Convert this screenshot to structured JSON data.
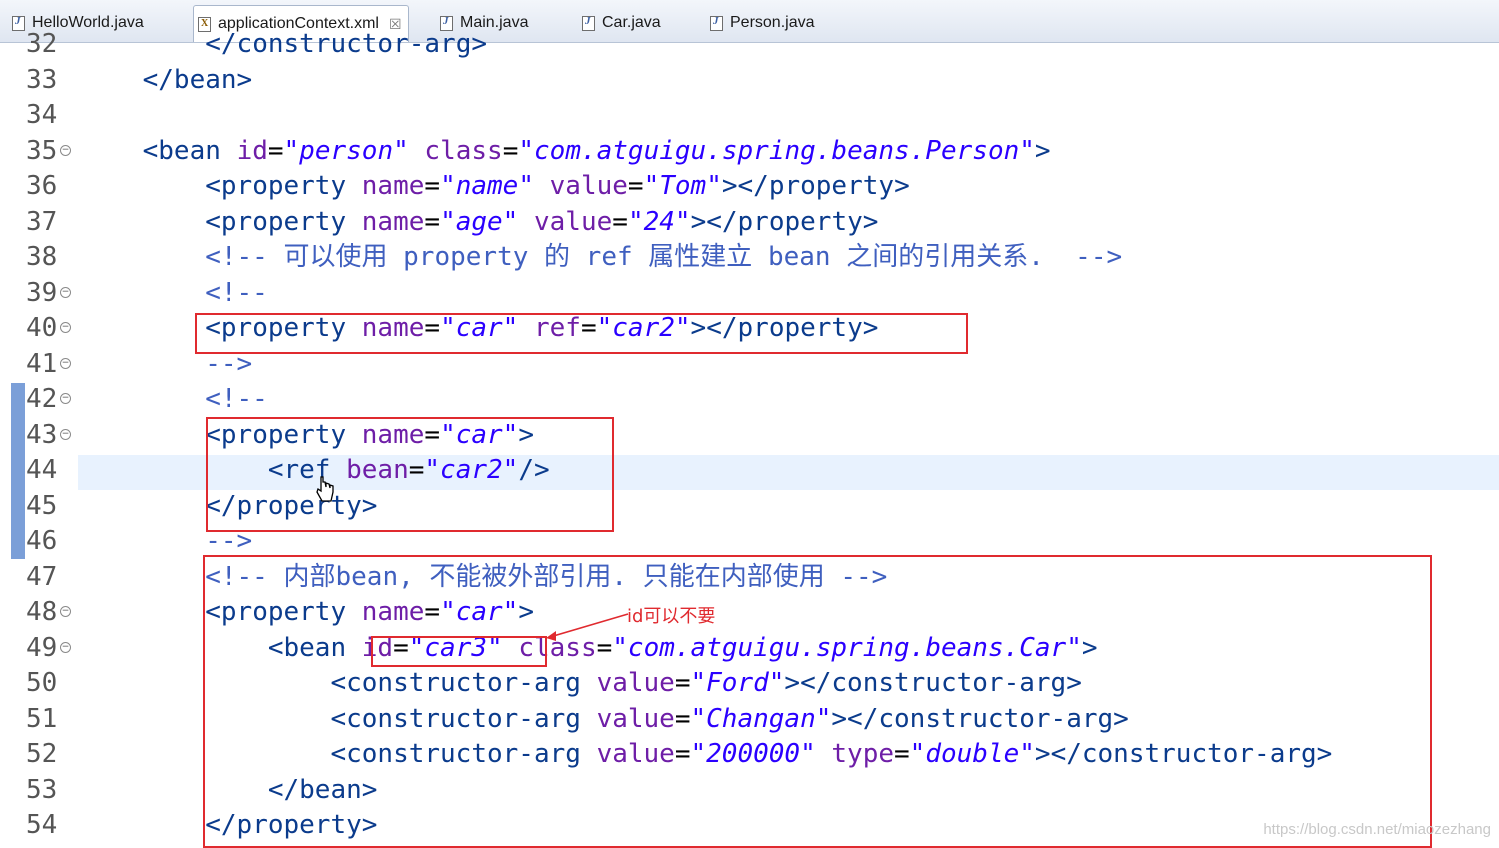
{
  "tabs": [
    {
      "label": "HelloWorld.java",
      "icon": "java-file-icon"
    },
    {
      "label": "applicationContext.xml",
      "icon": "xml-file-icon",
      "active": true,
      "close": "☒"
    },
    {
      "label": "Main.java",
      "icon": "java-file-icon"
    },
    {
      "label": "Car.java",
      "icon": "java-file-icon"
    },
    {
      "label": "Person.java",
      "icon": "java-file-icon"
    }
  ],
  "lines": [
    {
      "n": "32",
      "code": "        </constructor-arg>"
    },
    {
      "n": "33",
      "code": "    </bean>"
    },
    {
      "n": "34",
      "code": ""
    },
    {
      "n": "35",
      "code": "    <bean id=\"person\" class=\"com.atguigu.spring.beans.Person\">",
      "fold": true
    },
    {
      "n": "36",
      "code": "        <property name=\"name\" value=\"Tom\"></property>"
    },
    {
      "n": "37",
      "code": "        <property name=\"age\" value=\"24\"></property>"
    },
    {
      "n": "38",
      "code": "        <!-- 可以使用 property 的 ref 属性建立 bean 之间的引用关系.  -->"
    },
    {
      "n": "39",
      "code": "        <!--",
      "fold": true
    },
    {
      "n": "40",
      "code": "        <property name=\"car\" ref=\"car2\"></property>",
      "fold": true
    },
    {
      "n": "41",
      "code": "        -->",
      "fold": true
    },
    {
      "n": "42",
      "code": "        <!--",
      "fold": true
    },
    {
      "n": "43",
      "code": "        <property name=\"car\">",
      "fold": true
    },
    {
      "n": "44",
      "code": "            <ref bean=\"car2\"/>"
    },
    {
      "n": "45",
      "code": "        </property>"
    },
    {
      "n": "46",
      "code": "        -->"
    },
    {
      "n": "47",
      "code": "        <!-- 内部bean, 不能被外部引用. 只能在内部使用 -->"
    },
    {
      "n": "48",
      "code": "        <property name=\"car\">",
      "fold": true
    },
    {
      "n": "49",
      "code": "            <bean id=\"car3\" class=\"com.atguigu.spring.beans.Car\">",
      "fold": true
    },
    {
      "n": "50",
      "code": "                <constructor-arg value=\"Ford\"></constructor-arg>"
    },
    {
      "n": "51",
      "code": "                <constructor-arg value=\"Changan\"></constructor-arg>"
    },
    {
      "n": "52",
      "code": "                <constructor-arg value=\"200000\" type=\"double\"></constructor-arg>"
    },
    {
      "n": "53",
      "code": "            </bean>"
    },
    {
      "n": "54",
      "code": "        </property>"
    }
  ],
  "annotation": {
    "note": "id可以不要"
  },
  "watermark": "https://blog.csdn.net/miaozezhang",
  "colors": {
    "highlight_box": "#e02a2f",
    "tag": "#0b3b8c",
    "attribute": "#6e1ea7",
    "value": "#2a00ff",
    "comment": "#3f5fbf"
  }
}
